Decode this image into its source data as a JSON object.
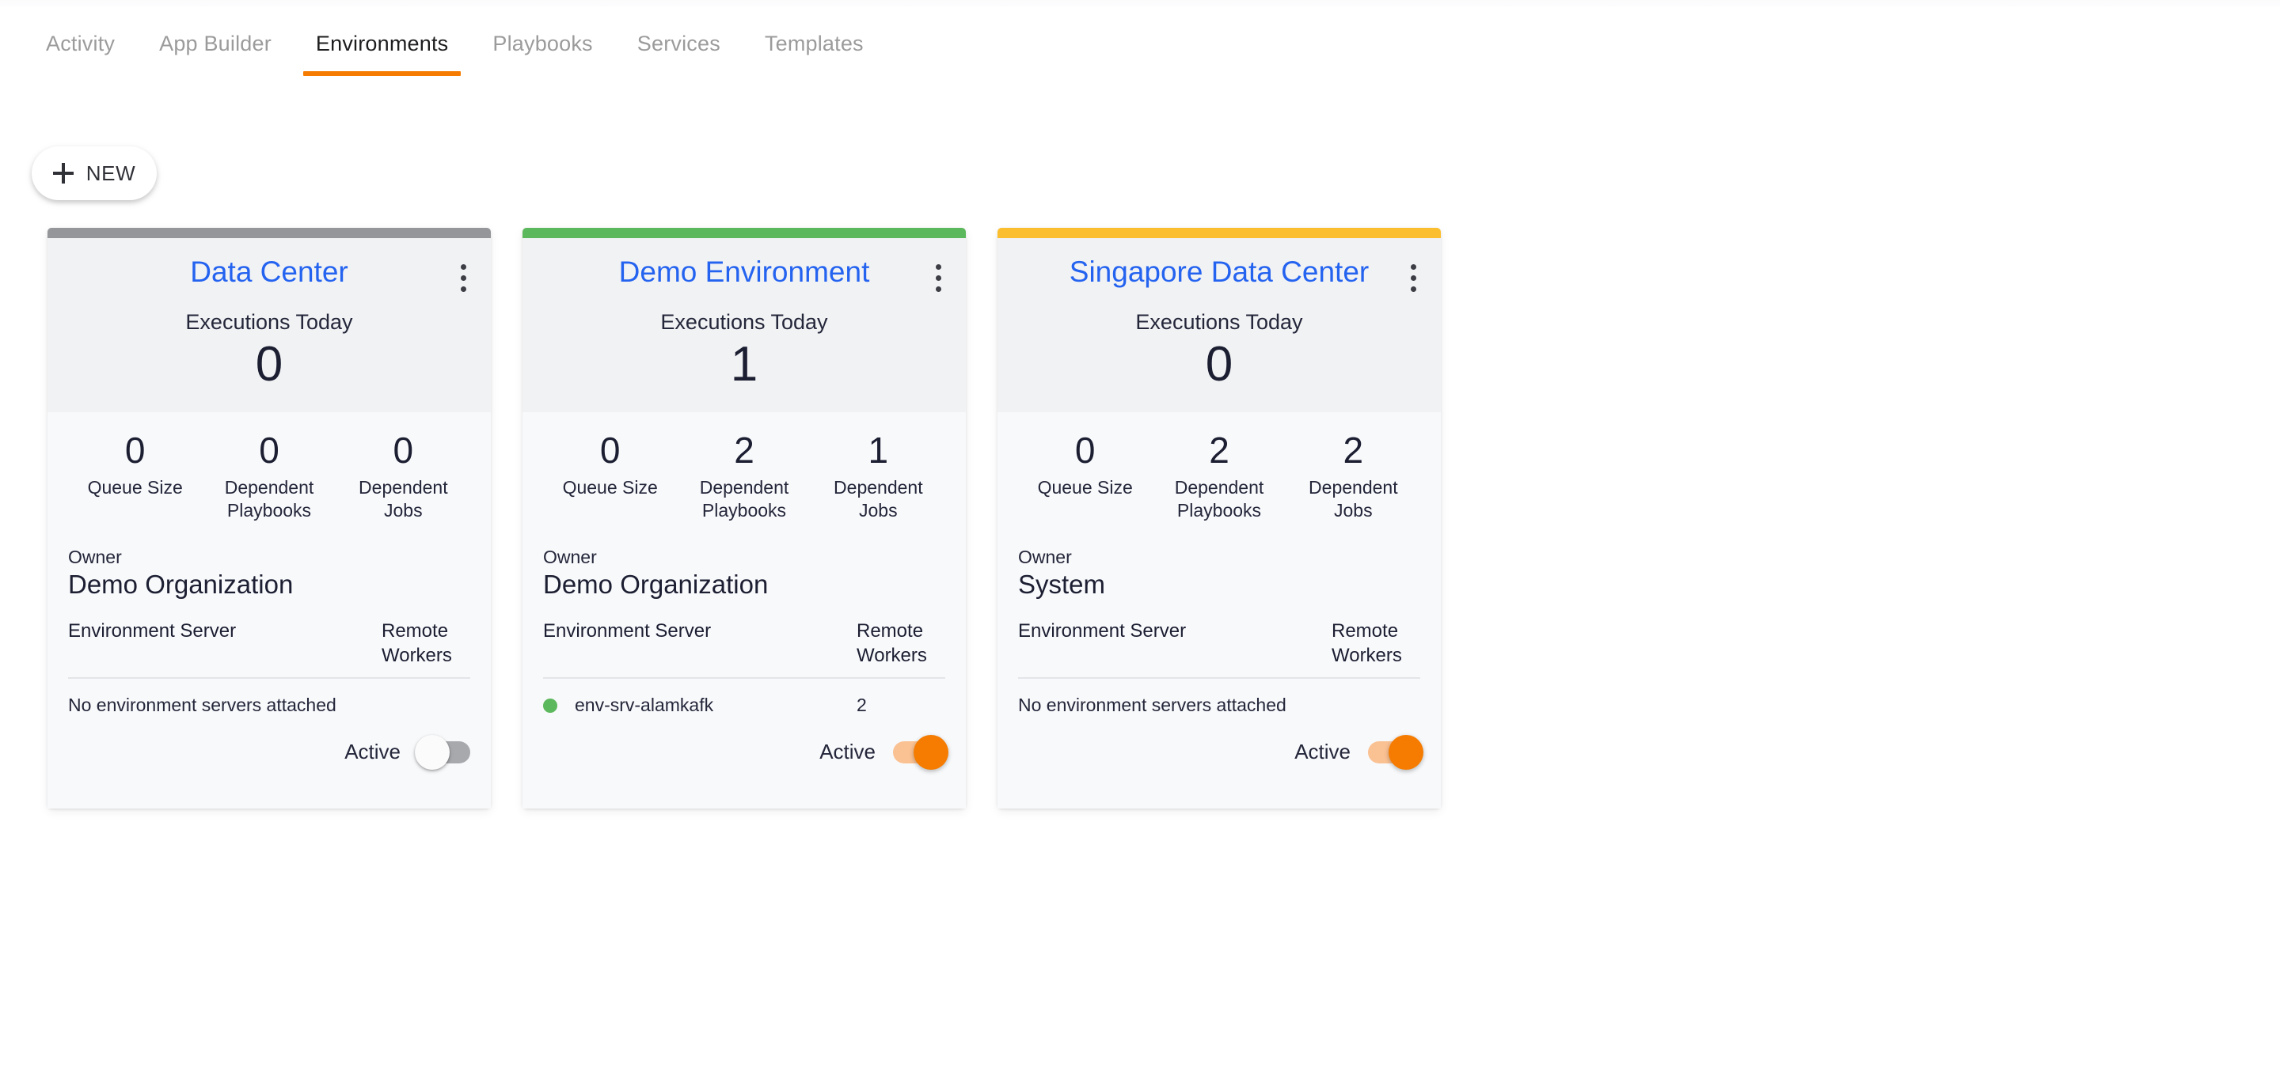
{
  "nav": {
    "tabs": [
      {
        "label": "Activity",
        "active": false
      },
      {
        "label": "App Builder",
        "active": false
      },
      {
        "label": "Environments",
        "active": true
      },
      {
        "label": "Playbooks",
        "active": false
      },
      {
        "label": "Services",
        "active": false
      },
      {
        "label": "Templates",
        "active": false
      }
    ],
    "active_underline_color": "#f57c00"
  },
  "toolbar": {
    "new_button_label": "NEW",
    "new_button_icon": "plus-icon"
  },
  "labels": {
    "executions_today": "Executions Today",
    "owner": "Owner",
    "environment_server": "Environment Server",
    "remote_workers": "Remote Workers",
    "no_servers": "No environment servers attached",
    "active": "Active",
    "menu_icon": "kebab-menu-icon"
  },
  "cards": [
    {
      "title": "Data Center",
      "accent_color": "#949699",
      "executions_today": "0",
      "stats": [
        {
          "value": "0",
          "label": "Queue Size"
        },
        {
          "value": "0",
          "label": "Dependent Playbooks"
        },
        {
          "value": "0",
          "label": "Dependent Jobs"
        }
      ],
      "owner": "Demo Organization",
      "servers": [],
      "empty_text": "No environment servers attached",
      "active": false
    },
    {
      "title": "Demo Environment",
      "accent_color": "#5cb85c",
      "executions_today": "1",
      "stats": [
        {
          "value": "0",
          "label": "Queue Size"
        },
        {
          "value": "2",
          "label": "Dependent Playbooks"
        },
        {
          "value": "1",
          "label": "Dependent Jobs"
        }
      ],
      "owner": "Demo Organization",
      "servers": [
        {
          "status": "online",
          "status_color": "#5cb85c",
          "name": "env-srv-alamkafk",
          "remote_workers": "2"
        }
      ],
      "empty_text": "",
      "active": true
    },
    {
      "title": "Singapore Data Center",
      "accent_color": "#fbbe2e",
      "executions_today": "0",
      "stats": [
        {
          "value": "0",
          "label": "Queue Size"
        },
        {
          "value": "2",
          "label": "Dependent Playbooks"
        },
        {
          "value": "2",
          "label": "Dependent Jobs"
        }
      ],
      "owner": "System",
      "servers": [],
      "empty_text": "No environment servers attached",
      "active": true
    }
  ]
}
